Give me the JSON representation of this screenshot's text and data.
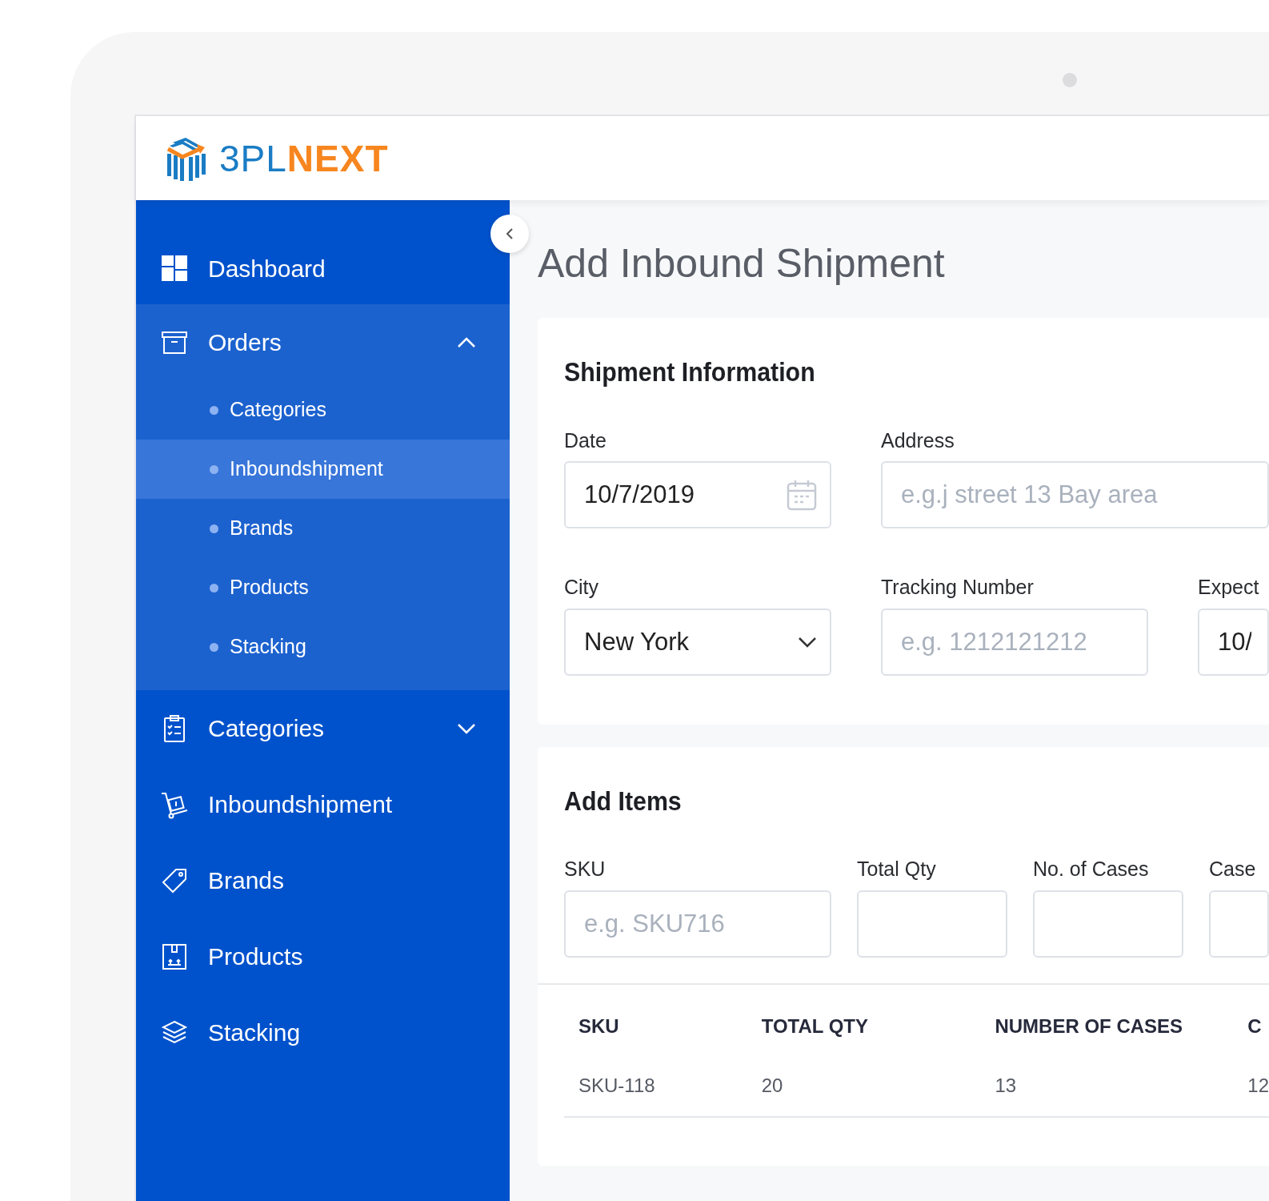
{
  "logo": {
    "text_primary": "3PL",
    "text_accent": "NEXT"
  },
  "sidebar": {
    "items": [
      {
        "kind": "link",
        "label": "Dashboard",
        "selected": false
      },
      {
        "kind": "group",
        "label": "Orders",
        "selected": false,
        "expanded": true,
        "children": [
          {
            "label": "Categories",
            "selected": false
          },
          {
            "label": "Inboundshipment",
            "selected": true
          },
          {
            "label": "Brands",
            "selected": false
          },
          {
            "label": "Products",
            "selected": false
          },
          {
            "label": "Stacking",
            "selected": false
          }
        ]
      },
      {
        "kind": "group",
        "label": "Categories",
        "selected": false,
        "expanded": false
      },
      {
        "kind": "link",
        "label": "Inboundshipment",
        "selected": false
      },
      {
        "kind": "link",
        "label": "Brands",
        "selected": false
      },
      {
        "kind": "link",
        "label": "Products",
        "selected": false
      },
      {
        "kind": "link",
        "label": "Stacking",
        "selected": false
      }
    ]
  },
  "page_title": "Add Inbound Shipment",
  "shipment_information": {
    "title": "Shipment Information",
    "rows": [
      [
        {
          "kind": "date",
          "label": "Date",
          "value": "10/7/2019"
        },
        {
          "kind": "text",
          "label": "Address",
          "placeholder": "e.g.j street 13 Bay area"
        }
      ],
      [
        {
          "kind": "select",
          "label": "City",
          "value": "New York"
        },
        {
          "kind": "text",
          "label": "Tracking Number",
          "placeholder": "e.g. 1212121212"
        },
        {
          "kind": "text",
          "label": "Expect",
          "value": "10/"
        }
      ]
    ]
  },
  "add_items": {
    "title": "Add Items",
    "fields": [
      {
        "label": "SKU",
        "placeholder": "e.g. SKU716"
      },
      {
        "label": "Total Qty"
      },
      {
        "label": "No. of Cases"
      },
      {
        "label": "Case"
      }
    ],
    "table": {
      "columns": [
        "SKU",
        "TOTAL QTY",
        "NUMBER OF CASES",
        "C"
      ],
      "rows": [
        [
          "SKU-118",
          "20",
          "13",
          "12"
        ]
      ]
    }
  }
}
